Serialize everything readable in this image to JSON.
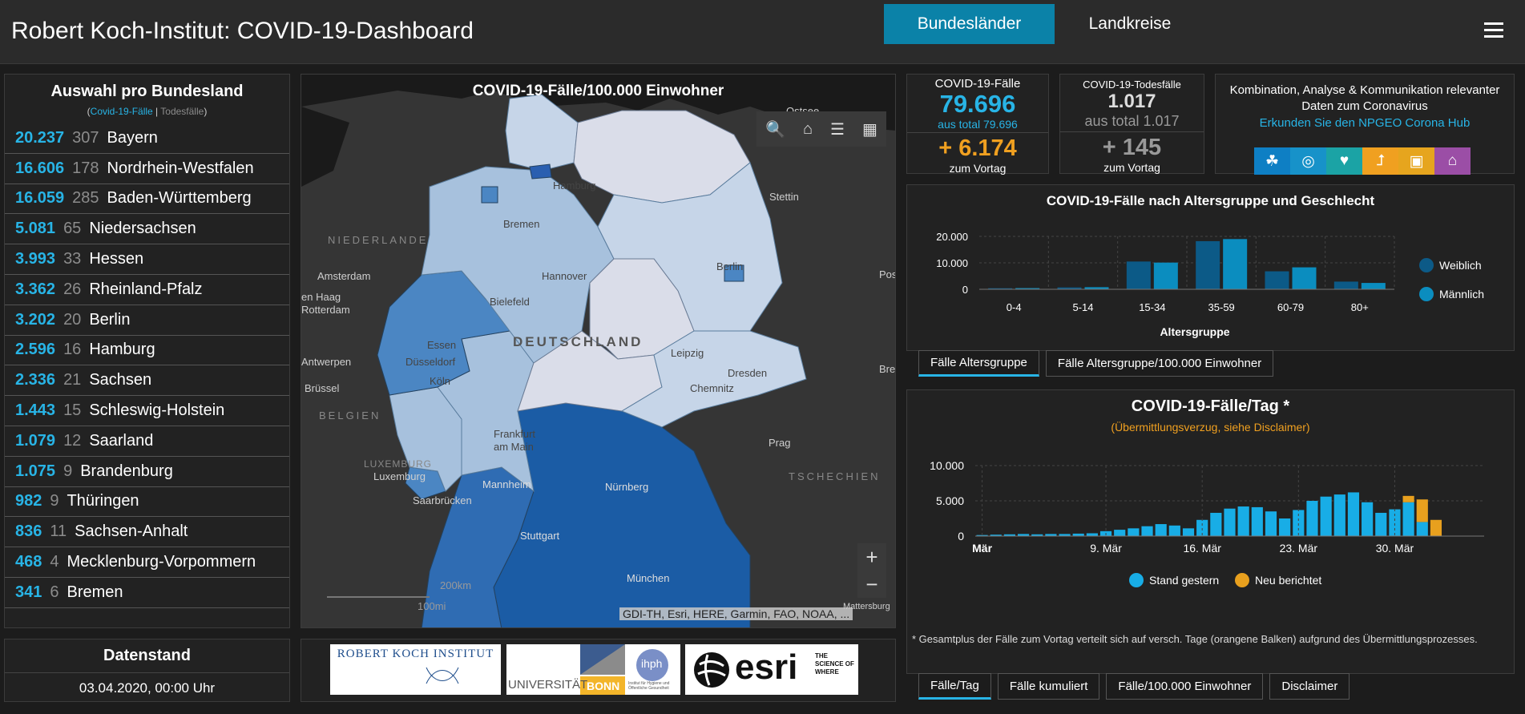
{
  "header": {
    "title": "Robert Koch-Institut: COVID-19-Dashboard",
    "tab_bundeslaender": "Bundesländer",
    "tab_landkreise": "Landkreise"
  },
  "left": {
    "title": "Auswahl pro Bundesland",
    "legend_cases": "Covid-19-Fälle",
    "legend_sep": " | ",
    "legend_deaths": "Todesfälle",
    "legend_open": "(",
    "legend_close": ")",
    "states": [
      {
        "cases": "20.237",
        "deaths": "307",
        "name": "Bayern"
      },
      {
        "cases": "16.606",
        "deaths": "178",
        "name": "Nordrhein-Westfalen"
      },
      {
        "cases": "16.059",
        "deaths": "285",
        "name": "Baden-Württemberg"
      },
      {
        "cases": "5.081",
        "deaths": "65",
        "name": "Niedersachsen"
      },
      {
        "cases": "3.993",
        "deaths": "33",
        "name": "Hessen"
      },
      {
        "cases": "3.362",
        "deaths": "26",
        "name": "Rheinland-Pfalz"
      },
      {
        "cases": "3.202",
        "deaths": "20",
        "name": "Berlin"
      },
      {
        "cases": "2.596",
        "deaths": "16",
        "name": "Hamburg"
      },
      {
        "cases": "2.336",
        "deaths": "21",
        "name": "Sachsen"
      },
      {
        "cases": "1.443",
        "deaths": "15",
        "name": "Schleswig-Holstein"
      },
      {
        "cases": "1.079",
        "deaths": "12",
        "name": "Saarland"
      },
      {
        "cases": "1.075",
        "deaths": "9",
        "name": "Brandenburg"
      },
      {
        "cases": "982",
        "deaths": "9",
        "name": "Thüringen"
      },
      {
        "cases": "836",
        "deaths": "11",
        "name": "Sachsen-Anhalt"
      },
      {
        "cases": "468",
        "deaths": "4",
        "name": "Mecklenburg-Vorpommern"
      },
      {
        "cases": "341",
        "deaths": "6",
        "name": "Bremen"
      }
    ]
  },
  "datenstand": {
    "title": "Datenstand",
    "value": "03.04.2020, 00:00 Uhr"
  },
  "map": {
    "title": "COVID-19-Fälle/100.000 Einwohner",
    "labels": {
      "ostsee": "Ostsee",
      "hamburg": "Hamburg",
      "stettin": "Stettin",
      "bremen": "Bremen",
      "niederlande": "NIEDERLANDE",
      "amsterdam": "Amsterdam",
      "hannover": "Hannover",
      "berlin": "Berlin",
      "pos": "Pos",
      "den_haag": "en Haag",
      "rotterdam": "Rotterdam",
      "bielefeld": "Bielefeld",
      "essen": "Essen",
      "deutschland": "DEUTSCHLAND",
      "duesseldorf": "Düsseldorf",
      "leipzig": "Leipzig",
      "antwerpen": "Antwerpen",
      "dresden": "Dresden",
      "bre": "Bre",
      "koeln": "Köln",
      "bruessel": "Brüssel",
      "chemnitz": "Chemnitz",
      "belgien": "BELGIEN",
      "frankfurt": "Frankfurt am Main",
      "prag": "Prag",
      "luxemburg_country": "LUXEMBURG",
      "luxemburg": "Luxemburg",
      "tschechien": "TSCHECHIEN",
      "mannheim": "Mannheim",
      "nuernberg": "Nürnberg",
      "saarbruecken": "Saarbrücken",
      "stuttgart": "Stuttgart",
      "muenchen": "München",
      "mattersburg": "Mattersburg"
    },
    "scale_km": "200km",
    "scale_mi": "100mi",
    "attribution": "GDI-TH, Esri, HERE, Garmin, FAO, NOAA, ...",
    "tools": {
      "search": "search-icon",
      "home": "home-icon",
      "list": "list-icon",
      "basemap": "basemap-icon",
      "zoom_in": "+",
      "zoom_out": "−"
    },
    "colors": {
      "bayern": "#1b5ca5",
      "bw": "#2f6cb3",
      "nrw": "#4b86c3",
      "rp": "#a7c1dd",
      "hessen": "#a7c1dd",
      "saarland": "#4b86c3",
      "nds": "#a7c1dd",
      "bremen": "#4b86c3",
      "hamburg": "#2a5fb0",
      "sh": "#c6d5e8",
      "mv": "#dadde9",
      "bb": "#c6d5e8",
      "berlin": "#4b86c3",
      "st": "#dadde9",
      "th": "#dadde9",
      "sn": "#c6d5e8"
    }
  },
  "logos": {
    "rki": "ROBERT KOCH INSTITUT",
    "uni": "UNIVERSITÄT",
    "bonn": "BONN",
    "ihph": "ihph",
    "ihph_sub": "Institut für Hygiene und Öffentliche Gesundheit",
    "esri": "esri",
    "esri_tag": "THE SCIENCE OF WHERE"
  },
  "kpi_cases": {
    "label": "COVID-19-Fälle",
    "value": "79.696",
    "sub": "aus total 79.696",
    "delta": "+ 6.174",
    "foot": "zum Vortag"
  },
  "kpi_deaths": {
    "label": "COVID-19-Todesfälle",
    "value": "1.017",
    "sub": "aus total 1.017",
    "delta": "+ 145",
    "foot": "zum Vortag"
  },
  "info": {
    "text": "Kombination, Analyse & Kommunikation relevanter Daten zum Coronavirus",
    "link": "Erkunden Sie den NPGEO Corona Hub",
    "icons": [
      {
        "name": "plant-icon",
        "color": "#0e7fc4"
      },
      {
        "name": "map-pin-icon",
        "color": "#1792c9"
      },
      {
        "name": "heart-icon",
        "color": "#1ba3a5"
      },
      {
        "name": "stairs-icon",
        "color": "#f0a020"
      },
      {
        "name": "car-icon",
        "color": "#e6a51e"
      },
      {
        "name": "building-icon",
        "color": "#9b4ea6"
      }
    ]
  },
  "age_tabs": [
    "Fälle Altersgruppe",
    "Fälle Altersgruppe/100.000 Einwohner"
  ],
  "day_tabs": [
    "Fälle/Tag",
    "Fälle kumuliert",
    "Fälle/100.000 Einwohner",
    "Disclaimer"
  ],
  "day_panel": {
    "subtitle": "(Übermittlungsverzug, siehe Disclaimer)",
    "footnote": "* Gesamtplus der Fälle zum Vortag verteilt sich auf versch. Tage (orangene Balken) aufgrund des Übermittlungsprozesses."
  },
  "chart_data": [
    {
      "type": "bar",
      "title": "COVID-19-Fälle nach Altersgruppe und Geschlecht",
      "xlabel": "Altersgruppe",
      "ylabel": "",
      "categories": [
        "0-4",
        "5-14",
        "15-34",
        "35-59",
        "60-79",
        "80+"
      ],
      "ylim": [
        0,
        20000
      ],
      "yticks": [
        "0",
        "10.000",
        "20.000"
      ],
      "legend_position": "right",
      "series": [
        {
          "name": "Weiblich",
          "color": "#0c5a87",
          "values": [
            400,
            700,
            10500,
            18200,
            6800,
            2900
          ]
        },
        {
          "name": "Männlich",
          "color": "#0b8dbf",
          "values": [
            450,
            800,
            10100,
            19000,
            8300,
            2400
          ]
        }
      ]
    },
    {
      "type": "bar",
      "stacked": true,
      "title": "COVID-19-Fälle/Tag *",
      "xlabel": "",
      "ylabel": "",
      "categories": [
        "1",
        "2",
        "3",
        "4",
        "5",
        "6",
        "7",
        "8",
        "9",
        "10",
        "11",
        "12",
        "13",
        "14",
        "15",
        "16",
        "17",
        "18",
        "19",
        "20",
        "21",
        "22",
        "23",
        "24",
        "25",
        "26",
        "27",
        "28",
        "29",
        "30",
        "31",
        "32",
        "33",
        "34",
        "35",
        "36",
        "37"
      ],
      "xticks": [
        {
          "label": "Mär",
          "index": 0
        },
        {
          "label": "9. Mär",
          "index": 9
        },
        {
          "label": "16. Mär",
          "index": 16
        },
        {
          "label": "23. Mär",
          "index": 23
        },
        {
          "label": "30. Mär",
          "index": 30
        }
      ],
      "ylim": [
        0,
        10000
      ],
      "yticks": [
        "0",
        "5.000",
        "10.000"
      ],
      "legend_position": "bottom",
      "series": [
        {
          "name": "Stand gestern",
          "color": "#18ade6",
          "values": [
            150,
            200,
            250,
            300,
            250,
            300,
            300,
            350,
            400,
            700,
            900,
            1100,
            1400,
            1700,
            1500,
            1100,
            2300,
            3300,
            3900,
            4200,
            4100,
            3500,
            2500,
            3700,
            5000,
            5600,
            5900,
            6200,
            4800,
            3300,
            3800,
            4800,
            2000,
            0,
            0,
            0,
            0
          ]
        },
        {
          "name": "Neu berichtet",
          "color": "#e8a01e",
          "values": [
            0,
            0,
            0,
            0,
            0,
            0,
            0,
            0,
            0,
            0,
            0,
            0,
            0,
            0,
            0,
            0,
            0,
            0,
            0,
            0,
            0,
            0,
            0,
            0,
            0,
            0,
            0,
            0,
            0,
            0,
            0,
            900,
            3200,
            2300,
            0,
            0,
            0
          ]
        }
      ]
    }
  ]
}
